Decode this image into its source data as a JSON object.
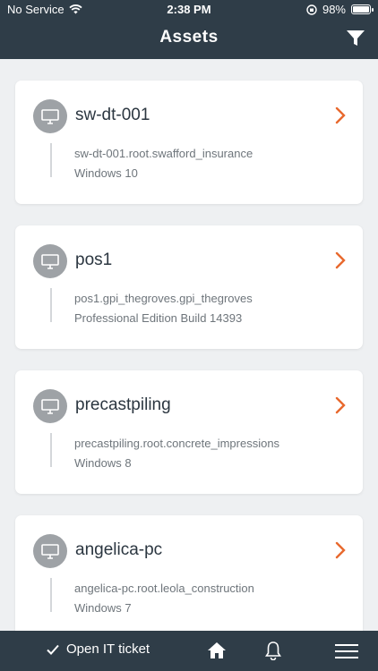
{
  "status_bar": {
    "carrier": "No Service",
    "time": "2:38 PM",
    "battery": "98%",
    "battery_level": 0.98
  },
  "header": {
    "title": "Assets",
    "filter_icon": "filter-icon"
  },
  "colors": {
    "header_bg": "#2f3d48",
    "accent": "#e8692e",
    "avatar_bg": "#9ea2a6"
  },
  "assets": [
    {
      "name": "sw-dt-001",
      "domain": "sw-dt-001.root.swafford_insurance",
      "os": "Windows 10",
      "icon": "desktop-icon"
    },
    {
      "name": "pos1",
      "domain": "pos1.gpi_thegroves.gpi_thegroves",
      "os": "Professional Edition Build 14393",
      "icon": "desktop-icon"
    },
    {
      "name": "precastpiling",
      "domain": "precastpiling.root.concrete_impressions",
      "os": "Windows 8",
      "icon": "desktop-icon"
    },
    {
      "name": "angelica-pc",
      "domain": "angelica-pc.root.leola_construction",
      "os": "Windows 7",
      "icon": "desktop-icon"
    }
  ],
  "bottom_bar": {
    "ticket_label": "Open IT ticket",
    "icons": [
      "checkmark-icon",
      "home-icon",
      "bell-icon",
      "hamburger-menu-icon"
    ]
  }
}
